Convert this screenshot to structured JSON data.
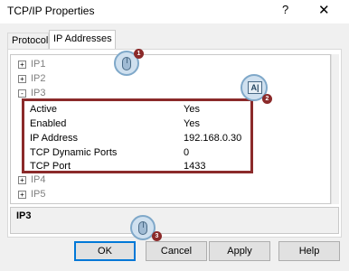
{
  "window": {
    "title": "TCP/IP Properties",
    "help_glyph": "?",
    "close_glyph": "✕"
  },
  "tabs": [
    {
      "label": "Protocol",
      "selected": false
    },
    {
      "label": "IP Addresses",
      "selected": true
    }
  ],
  "tree": {
    "items_top": [
      {
        "label": "IP1",
        "toggle": "+"
      },
      {
        "label": "IP2",
        "toggle": "+"
      },
      {
        "label": "IP3",
        "toggle": "-"
      }
    ],
    "properties": [
      {
        "key": "Active",
        "value": "Yes"
      },
      {
        "key": "Enabled",
        "value": "Yes"
      },
      {
        "key": "IP Address",
        "value": "192.168.0.30"
      },
      {
        "key": "TCP Dynamic Ports",
        "value": "0"
      },
      {
        "key": "TCP Port",
        "value": "1433"
      }
    ],
    "items_bottom": [
      {
        "label": "IP4",
        "toggle": "+"
      },
      {
        "label": "IP5",
        "toggle": "+"
      }
    ]
  },
  "description": {
    "text": "IP3"
  },
  "buttons": {
    "ok": "OK",
    "cancel": "Cancel",
    "apply": "Apply",
    "help": "Help"
  },
  "callouts": {
    "step1": "1",
    "step2": "2",
    "step3": "3",
    "ai_glyph": "A|"
  },
  "colors": {
    "highlight_border": "#8b2a2a",
    "default_button_border": "#0078d7"
  }
}
